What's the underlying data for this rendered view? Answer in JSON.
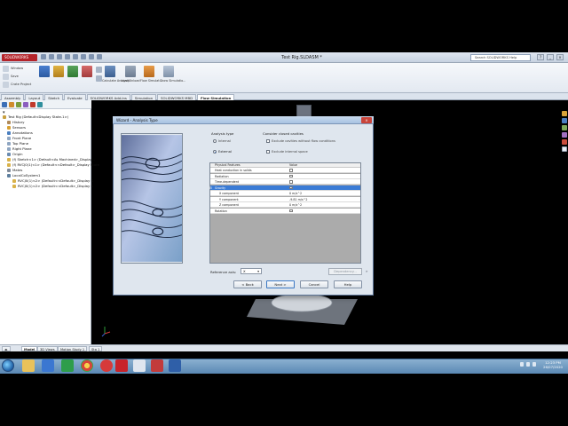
{
  "window": {
    "app_logo": "SOLIDWORKS",
    "title": "Test Rig.SLDASM *",
    "search_placeholder": "Search SOLIDWORKS Help",
    "controls": [
      "?",
      "_",
      "×"
    ]
  },
  "ribbon": {
    "left_small": [
      "Window",
      "Save",
      "Crate Project"
    ],
    "mid_labels": [
      "Calculate Analysis",
      "Load/Unload",
      "Flow Simulat...",
      "Show Simulatio..."
    ]
  },
  "command_tabs": {
    "items": [
      "Assembly",
      "Layout",
      "Sketch",
      "Evaluate",
      "SOLIDWORKS Add-Ins",
      "Simulation",
      "SOLIDWORKS MBD",
      "Flow Simulation"
    ],
    "active_index": 7
  },
  "tree": {
    "items": [
      "Test Rig  (Default<Display State-1>)",
      "History",
      "Sensors",
      "Annotations",
      "Front Plane",
      "Top Plane",
      "Right Plane",
      "Origin",
      "(f) Sketch<1> (Default<As Machined>_Display...",
      "(f) RVCJ0(1)<1> (Default<<Default>_Display State",
      "Mates",
      "LocalCoSystem1",
      "RVCJ0(1)<2> (Default<<Default>_Display S",
      "RVCJ0(1)<2> (Default<<Default>_Display S"
    ]
  },
  "dialog": {
    "title": "Wizard - Analysis Type",
    "close_glyph": "×",
    "analysis_type_label": "Analysis type",
    "internal_label": "Internal",
    "external_label": "External",
    "selected_analysis": "External",
    "closed_cavities_label": "Consider closed cavities",
    "exclude_cavities_label": "Exclude cavities without flow conditions",
    "exclude_internal_label": "Exclude internal space",
    "grid": {
      "headers": [
        "Physical Features",
        "Value"
      ],
      "rows": [
        {
          "name": "Heat conduction in solids",
          "value": "",
          "checked": false,
          "indent": 0,
          "selected": false
        },
        {
          "name": "Radiation",
          "value": "",
          "checked": false,
          "indent": 0,
          "selected": false
        },
        {
          "name": "Time-dependent",
          "value": "",
          "checked": false,
          "indent": 0,
          "selected": false
        },
        {
          "name": "Gravity",
          "value": "",
          "checked": true,
          "indent": 0,
          "selected": true
        },
        {
          "name": "X component",
          "value": "0 m/s^2",
          "checked": null,
          "indent": 1,
          "selected": false
        },
        {
          "name": "Y component",
          "value": "-9.81 m/s^2",
          "checked": null,
          "indent": 1,
          "selected": false
        },
        {
          "name": "Z component",
          "value": "0 m/s^2",
          "checked": null,
          "indent": 1,
          "selected": false
        },
        {
          "name": "Rotation",
          "value": "",
          "checked": false,
          "indent": 0,
          "selected": false
        }
      ]
    },
    "reference_axis_label": "Reference axis:",
    "reference_axis_value": "X",
    "dependency_label": "Dependency...",
    "buttons": {
      "back": "< Back",
      "next": "Next >",
      "cancel": "Cancel",
      "help": "Help"
    }
  },
  "bottom_tabs": {
    "items": [
      "Model",
      "3D Views",
      "Motion Study 1",
      "Sta 1"
    ],
    "active_index": 0
  },
  "taskbar": {
    "time": "12:23 PM",
    "date": "26/07/2020"
  }
}
